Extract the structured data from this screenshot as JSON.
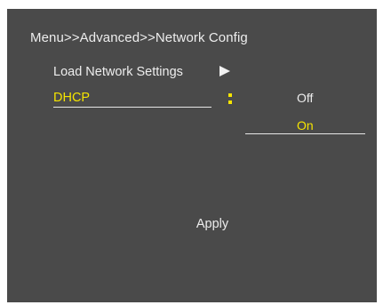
{
  "header": {
    "breadcrumb": "Menu>>Advanced>>Network Config"
  },
  "menu": {
    "items": [
      {
        "label": "Load Network Settings",
        "icon": "play-arrow-icon"
      },
      {
        "label": "DHCP",
        "icon": "colon-separator-icon"
      }
    ]
  },
  "dhcp_options": {
    "options": [
      "Off",
      "On"
    ],
    "selected": "On"
  },
  "footer": {
    "apply_label": "Apply"
  },
  "colors": {
    "background": "#4a4a4a",
    "text": "#ededed",
    "highlight": "#f5e400"
  }
}
